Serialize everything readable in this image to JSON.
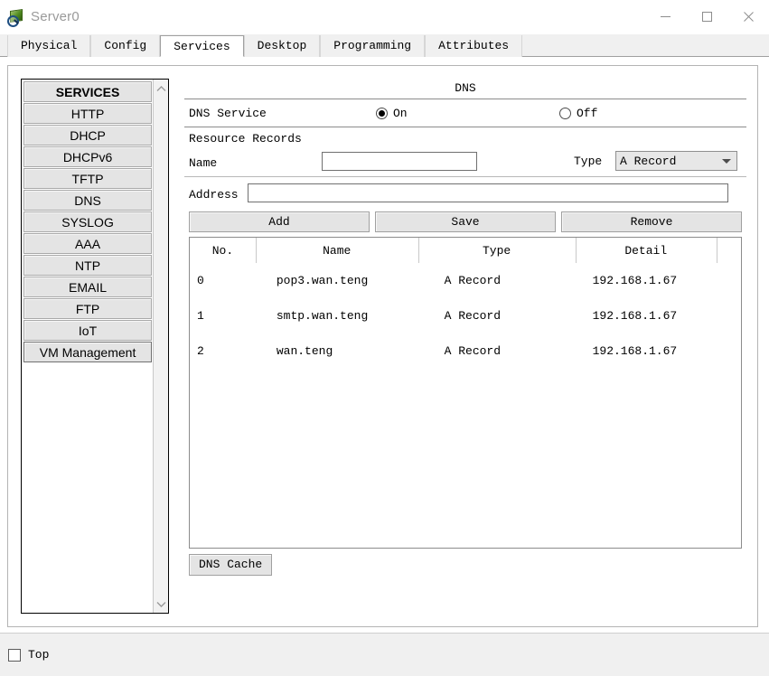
{
  "window": {
    "title": "Server0",
    "icon": "packet-tracer-icon",
    "controls": {
      "minimize": "minimize-icon",
      "maximize": "maximize-icon",
      "close": "close-icon"
    }
  },
  "tabs": [
    {
      "label": "Physical",
      "active": false
    },
    {
      "label": "Config",
      "active": false
    },
    {
      "label": "Services",
      "active": true
    },
    {
      "label": "Desktop",
      "active": false
    },
    {
      "label": "Programming",
      "active": false
    },
    {
      "label": "Attributes",
      "active": false
    }
  ],
  "sidebar": {
    "header": "SERVICES",
    "items": [
      {
        "label": "HTTP",
        "selected": false
      },
      {
        "label": "DHCP",
        "selected": false
      },
      {
        "label": "DHCPv6",
        "selected": false
      },
      {
        "label": "TFTP",
        "selected": false
      },
      {
        "label": "DNS",
        "selected": false
      },
      {
        "label": "SYSLOG",
        "selected": false
      },
      {
        "label": "AAA",
        "selected": false
      },
      {
        "label": "NTP",
        "selected": false
      },
      {
        "label": "EMAIL",
        "selected": false
      },
      {
        "label": "FTP",
        "selected": false
      },
      {
        "label": "IoT",
        "selected": false
      },
      {
        "label": "VM Management",
        "selected": true
      }
    ],
    "scroll_up_icon": "chevron-up-icon",
    "scroll_down_icon": "chevron-down-icon"
  },
  "main": {
    "title": "DNS",
    "service": {
      "label": "DNS Service",
      "on_label": "On",
      "off_label": "Off",
      "value": "On"
    },
    "resource_records": {
      "section_label": "Resource Records",
      "name_label": "Name",
      "name_value": "",
      "name_placeholder": "",
      "type_label": "Type",
      "type_value": "A Record",
      "address_label": "Address",
      "address_value": "",
      "address_placeholder": ""
    },
    "buttons": {
      "add": "Add",
      "save": "Save",
      "remove": "Remove"
    },
    "table": {
      "columns": [
        "No.",
        "Name",
        "Type",
        "Detail"
      ],
      "rows": [
        {
          "no": "0",
          "name": "pop3.wan.teng",
          "type": "A Record",
          "detail": "192.168.1.67"
        },
        {
          "no": "1",
          "name": "smtp.wan.teng",
          "type": "A Record",
          "detail": "192.168.1.67"
        },
        {
          "no": "2",
          "name": "wan.teng",
          "type": "A Record",
          "detail": "192.168.1.67"
        }
      ]
    },
    "cache_button": "DNS Cache"
  },
  "bottom": {
    "top_label": "Top",
    "top_checked": false
  }
}
